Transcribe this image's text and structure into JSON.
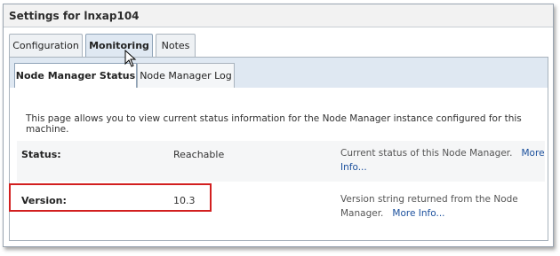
{
  "window": {
    "title": "Settings for lnxap104"
  },
  "tabs": [
    {
      "label": "Configuration",
      "active": false
    },
    {
      "label": "Monitoring",
      "active": true
    },
    {
      "label": "Notes",
      "active": false
    }
  ],
  "subtabs": [
    {
      "label": "Node Manager Status",
      "active": true
    },
    {
      "label": "Node Manager Log",
      "active": false
    }
  ],
  "intro": "This page allows you to view current status information for the Node Manager instance configured for this machine.",
  "fields": {
    "status": {
      "label": "Status:",
      "value": "Reachable",
      "description": "Current status of this Node Manager.",
      "more_info": "More Info..."
    },
    "version": {
      "label": "Version:",
      "value": "10.3",
      "description": "Version string returned from the Node Manager.",
      "more_info": "More Info..."
    }
  },
  "colors": {
    "highlight": "#d21f1f",
    "link": "#1a4f9c",
    "active_tab": "#dfe8f2"
  },
  "icons": {
    "cursor": "mouse-pointer-icon"
  }
}
